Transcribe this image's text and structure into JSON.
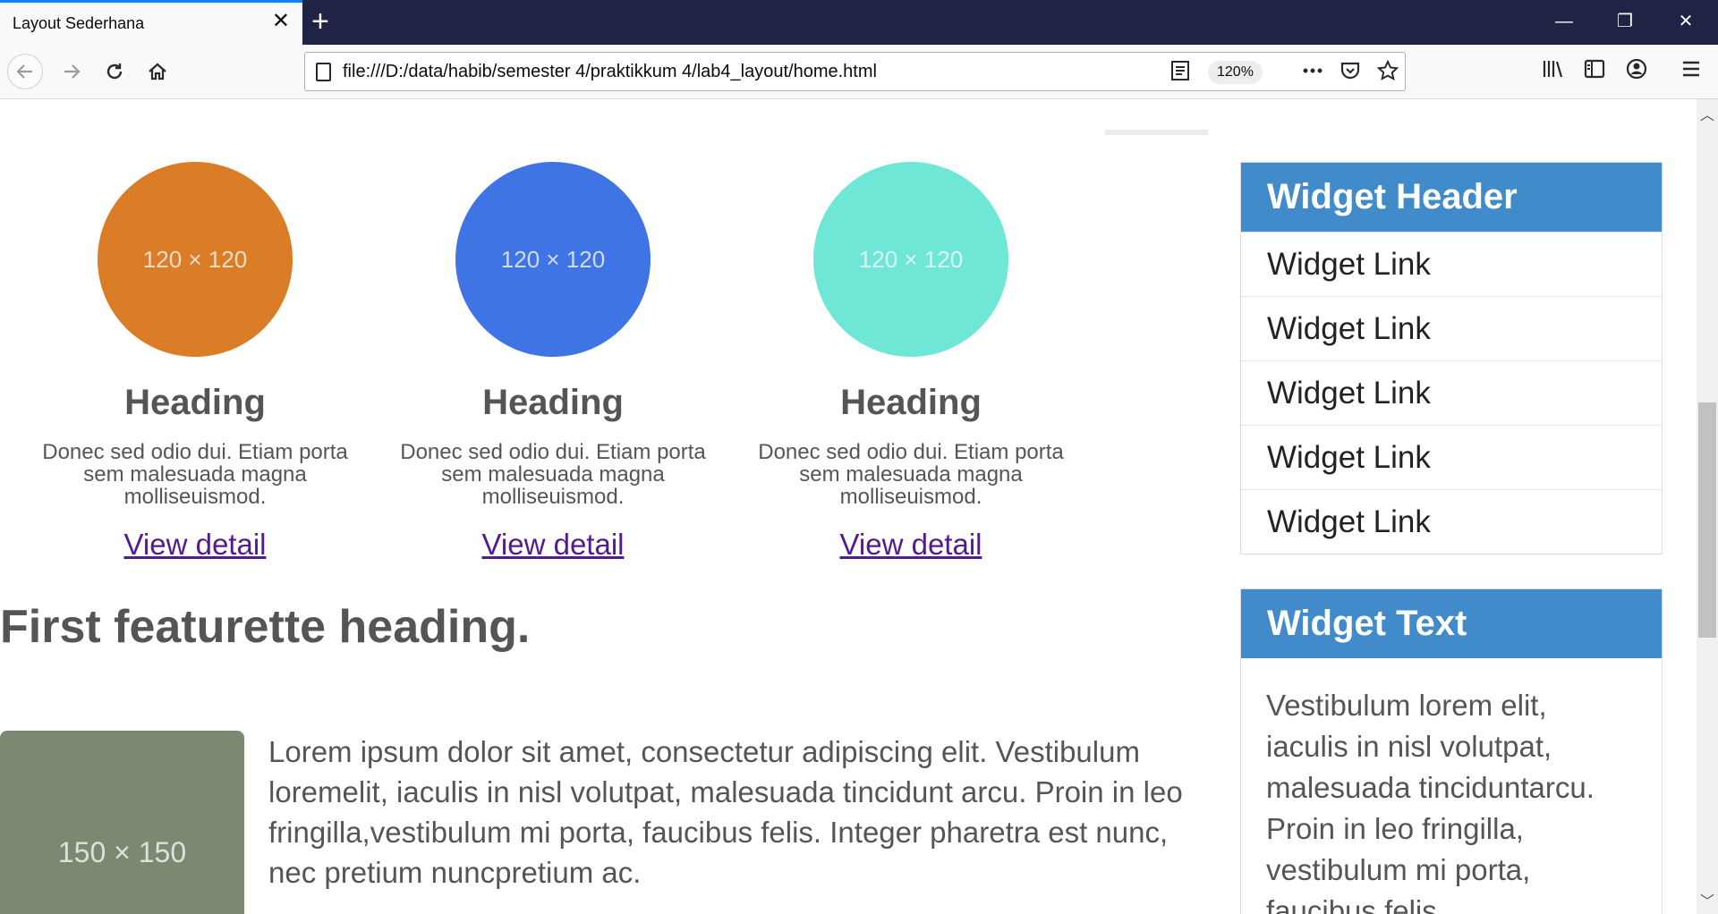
{
  "browser": {
    "tab_title": "Layout Sederhana",
    "tab_close": "✕",
    "new_tab": "+",
    "url": "file:///D:/data/habib/semester 4/praktikkum 4/lab4_layout/home.html",
    "zoom": "120%",
    "window": {
      "minimize": "—",
      "restore": "❐",
      "close": "✕"
    }
  },
  "columns": [
    {
      "image_label": "120 × 120",
      "image_color": "#db7d27",
      "heading": "Heading",
      "text": "Donec sed odio dui. Etiam porta sem malesuada magna molliseuismod.",
      "link": "View detail"
    },
    {
      "image_label": "120 × 120",
      "image_color": "#3f74e5",
      "heading": "Heading",
      "text": "Donec sed odio dui. Etiam porta sem malesuada magna molliseuismod.",
      "link": "View detail"
    },
    {
      "image_label": "120 × 120",
      "image_color": "#6fe7d6",
      "heading": "Heading",
      "text": "Donec sed odio dui. Etiam porta sem malesuada magna molliseuismod.",
      "link": "View detail"
    }
  ],
  "featurette": {
    "heading": "First featurette heading.",
    "image_label": "150 × 150",
    "image_color": "#7b8872",
    "text": "Lorem ipsum dolor sit amet, consectetur adipiscing elit. Vestibulum loremelit, iaculis in nisl volutpat, malesuada tincidunt arcu. Proin in leo fringilla,vestibulum mi porta, faucibus felis. Integer pharetra est nunc, nec pretium nuncpretium ac."
  },
  "sidebar": {
    "widget1": {
      "header": "Widget Header",
      "links": [
        "Widget Link",
        "Widget Link",
        "Widget Link",
        "Widget Link",
        "Widget Link"
      ]
    },
    "widget2": {
      "header": "Widget Text",
      "text": "Vestibulum lorem elit, iaculis in nisl volutpat, malesuada tinciduntarcu. Proin in leo fringilla, vestibulum mi porta, faucibus felis."
    }
  },
  "colors": {
    "widget_header": "#428bca",
    "link_visited": "#551a8b",
    "tabstrip": "#1f2344"
  }
}
